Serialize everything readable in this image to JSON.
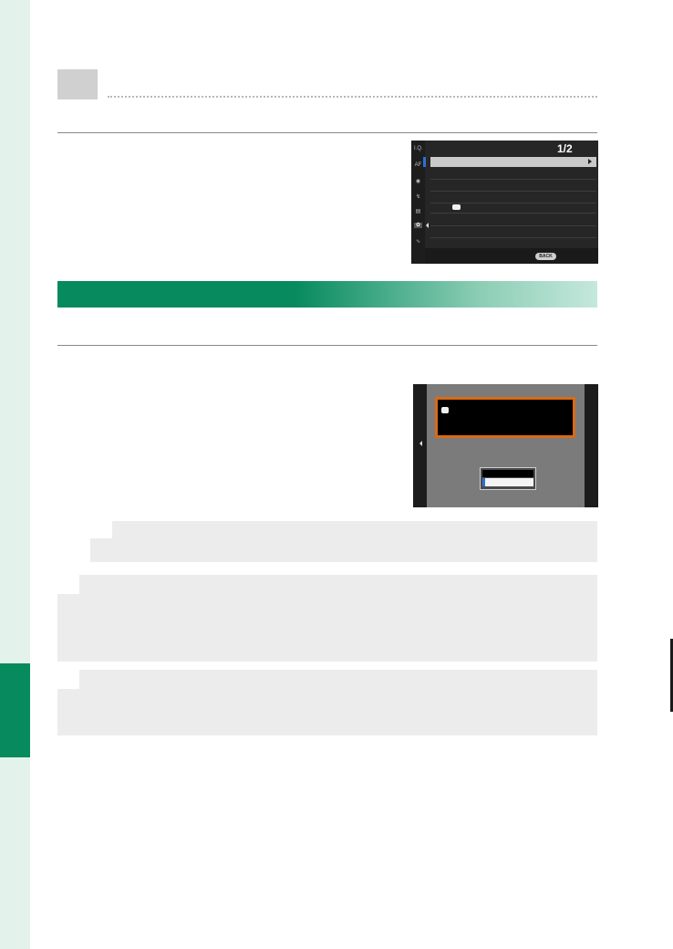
{
  "menu_screen": {
    "page_indicator": "1/2",
    "sidebar_icons": [
      "image-quality-icon",
      "af-mf-icon",
      "camera-icon",
      "flash-icon",
      "movie-icon",
      "wrench-icon",
      "network-icon"
    ],
    "back_button_label": "BACK",
    "row_count": 8
  },
  "colors": {
    "accent_green": "#078a5e",
    "sidebar_tint": "#e4f2ec",
    "dialog_highlight": "#d96a14",
    "cursor_blue": "#2d6fd6"
  }
}
